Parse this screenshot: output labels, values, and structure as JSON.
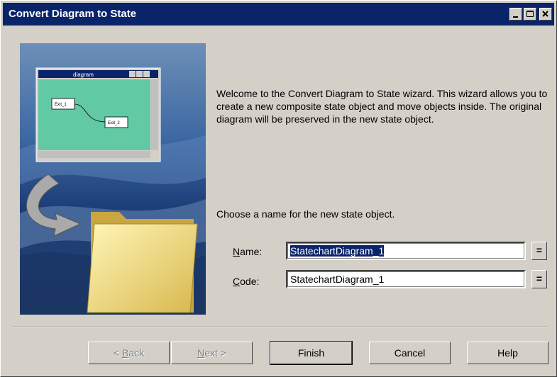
{
  "window": {
    "title": "Convert Diagram to State",
    "controls": [
      "minimize-icon",
      "maximize-icon",
      "close-icon"
    ]
  },
  "illustration": {
    "mini_window_title": "diagram",
    "node1": "Exit_1",
    "node2": "Exit_2",
    "background_color": "#62c9a5"
  },
  "wizard": {
    "welcome_text": "Welcome to the Convert Diagram to State wizard. This wizard allows you to create a new composite state object and move objects inside. The original diagram will be preserved in the new state object.",
    "prompt": "Choose a name for the new state object.",
    "name_label_first": "N",
    "name_label_rest": "ame:",
    "name_value": "StatechartDiagram_1",
    "code_label_first": "C",
    "code_label_rest": "ode:",
    "code_value": "StatechartDiagram_1",
    "eq_button": "="
  },
  "buttons": {
    "back_prefix": "< ",
    "back_ul": "B",
    "back_rest": "ack",
    "next_ul": "N",
    "next_rest": "ext >",
    "finish": "Finish",
    "cancel": "Cancel",
    "help": "Help"
  },
  "colors": {
    "titlebar": "#0a246a",
    "dialog": "#d4d0c8"
  }
}
